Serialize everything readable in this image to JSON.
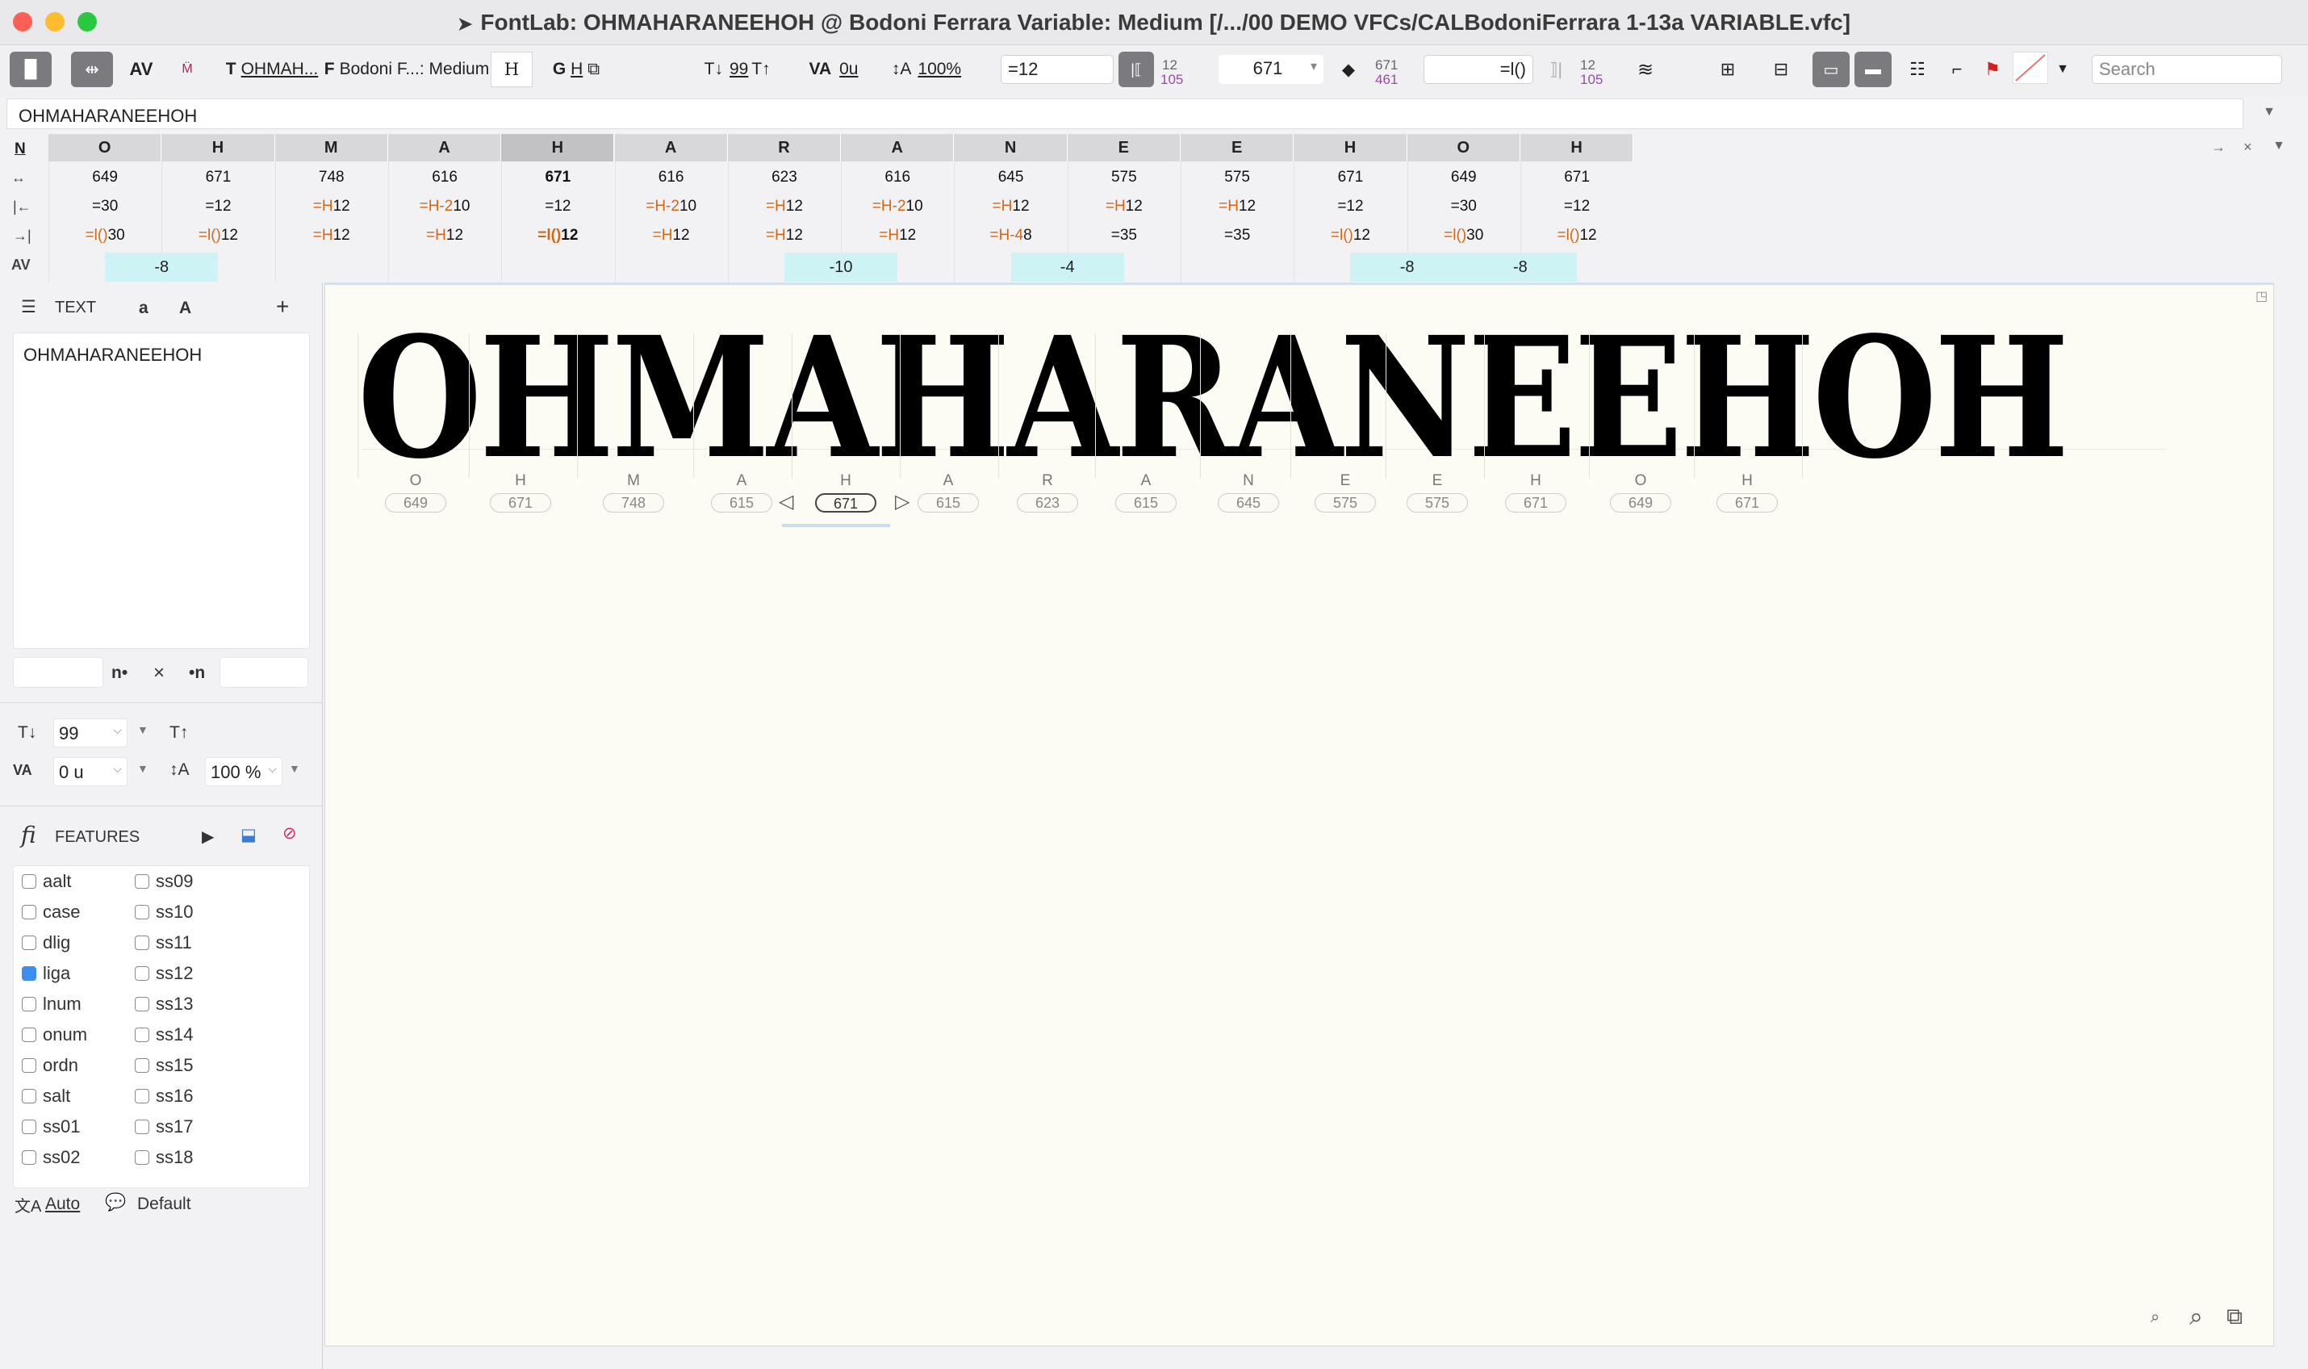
{
  "window": {
    "title": "FontLab: OHMAHARANEEHOH @ Bodoni Ferrara Variable: Medium [/.../00 DEMO VFCs/CALBodoniFerrara 1-13a VARIABLE.vfc]"
  },
  "toolbar": {
    "text_label": "OHMAH...",
    "font_label": "Bodoni F...: Medium",
    "glyph_h": "H",
    "glyph_g": "G",
    "glyph_g_h": "H",
    "font_size": "99",
    "tracking": "0u",
    "line_spacing": "100%",
    "lsb_value": "=12",
    "lsb_small_top": "12",
    "lsb_small_bottom": "105",
    "width_value": "671",
    "width_small_top": "671",
    "width_small_bottom": "461",
    "rsb_value": "=l()",
    "rsb_small_top": "12",
    "rsb_small_bottom": "105",
    "search_placeholder": "Search"
  },
  "textbar": {
    "value": "OHMAHARANEEHOH"
  },
  "metrics": {
    "row_label_n": "N",
    "glyphs": [
      "O",
      "H",
      "M",
      "A",
      "H",
      "A",
      "R",
      "A",
      "N",
      "E",
      "E",
      "H",
      "O",
      "H"
    ],
    "widths": [
      "649",
      "671",
      "748",
      "616",
      "671",
      "616",
      "623",
      "616",
      "645",
      "575",
      "575",
      "671",
      "649",
      "671"
    ],
    "lsb_pre": [
      "",
      "",
      "=H",
      "=H-2",
      "",
      "=H-2",
      "=H",
      "=H-2",
      "=H",
      "=H",
      "=H",
      "",
      "",
      ""
    ],
    "lsb": [
      "=30",
      "=12",
      "12",
      "10",
      "=12",
      "10",
      "12",
      "10",
      "12",
      "12",
      "12",
      "=12",
      "=30",
      "=12"
    ],
    "rsb_pre": [
      "=l()",
      "=l()",
      "=H",
      "=H",
      "=l()",
      "=H",
      "=H",
      "=H",
      "=H-4",
      "",
      "",
      "=l()",
      "=l()",
      "=l()"
    ],
    "rsb": [
      "30",
      "12",
      "12",
      "12",
      "12",
      "12",
      "12",
      "12",
      "8",
      "=35",
      "=35",
      "12",
      "30",
      "12"
    ],
    "kerns": [
      "-8",
      "-10",
      "-4",
      "-8",
      "-8"
    ]
  },
  "sidebar": {
    "text_title": "TEXT",
    "lower_a": "a",
    "upper_a": "A",
    "plus": "+",
    "text_content": "OHMAHARANEEHOH",
    "n_left": "n•",
    "x_mark": "×",
    "n_right": "•n",
    "size": "99",
    "tracking": "0 u",
    "line_spacing": "100 %",
    "features_title": "FEATURES",
    "features_col1": [
      "aalt",
      "case",
      "dlig",
      "liga",
      "lnum",
      "onum",
      "ordn",
      "salt",
      "ss01",
      "ss02"
    ],
    "features_col2": [
      "ss09",
      "ss10",
      "ss11",
      "ss12",
      "ss13",
      "ss14",
      "ss15",
      "ss16",
      "ss17",
      "ss18"
    ],
    "liga_checked": true,
    "auto_label": "Auto",
    "default_label": "Default"
  },
  "canvas": {
    "text": "OHMAHARANEEHOH",
    "names": [
      "O",
      "H",
      "M",
      "A",
      "H",
      "A",
      "R",
      "A",
      "N",
      "E",
      "E",
      "H",
      "O",
      "H"
    ],
    "advances": [
      "649",
      "671",
      "748",
      "615",
      "671",
      "615",
      "623",
      "615",
      "645",
      "575",
      "575",
      "671",
      "649",
      "671"
    ]
  }
}
